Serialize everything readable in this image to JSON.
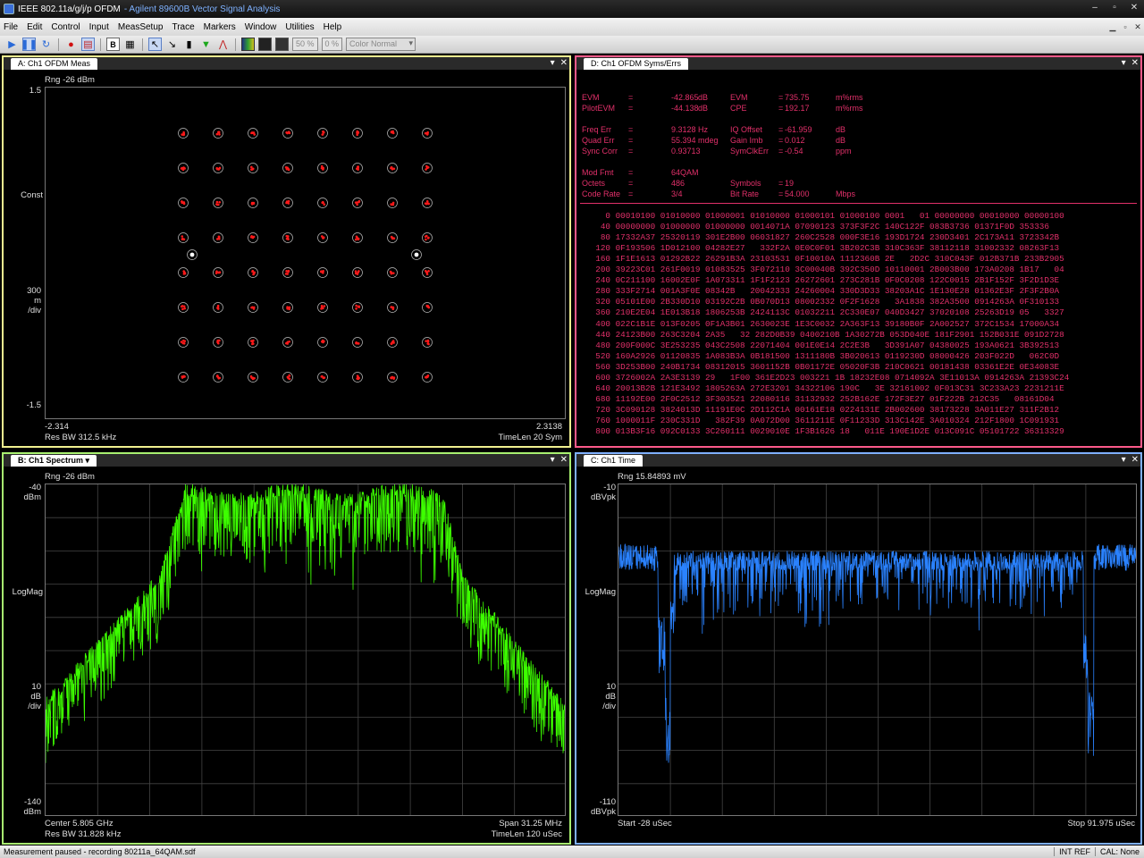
{
  "window": {
    "title": "IEEE 802.11a/g/j/p OFDM",
    "app": "- Agilent 89600B Vector Signal Analysis",
    "buttons": [
      "–",
      "▫",
      "✕"
    ]
  },
  "menu": [
    "File",
    "Edit",
    "Control",
    "Input",
    "MeasSetup",
    "Trace",
    "Markers",
    "Window",
    "Utilities",
    "Help"
  ],
  "toolbar": {
    "zoom1": "50 %",
    "zoom2": "0 %",
    "color_scheme": "Color Normal"
  },
  "panes": {
    "a": {
      "tab": "A: Ch1 OFDM Meas",
      "range": "Rng -26 dBm",
      "y_top": "1.5",
      "y_mid": "Const",
      "y_scale": [
        "300",
        "m",
        "/div"
      ],
      "y_bottom": "-1.5",
      "x_left": "-2.314",
      "x_right": "2.3138",
      "foot_left": "Res BW 312.5 kHz",
      "foot_right": "TimeLen 20  Sym"
    },
    "b": {
      "tab": "B: Ch1 Spectrum",
      "range": "Rng -26 dBm",
      "y_top": [
        "-40",
        "dBm"
      ],
      "y_mid": "LogMag",
      "y_scale": [
        "10",
        "dB",
        "/div"
      ],
      "y_bottom": [
        "-140",
        "dBm"
      ],
      "foot_left_1": "Center 5.805 GHz",
      "foot_right_1": "Span 31.25 MHz",
      "foot_left_2": "Res BW 31.828 kHz",
      "foot_right_2": "TimeLen 120 uSec"
    },
    "c": {
      "tab": "C: Ch1 Time",
      "range": "Rng 15.84893 mV",
      "y_top": [
        "-10",
        "dBVpk"
      ],
      "y_mid": "LogMag",
      "y_scale": [
        "10",
        "dB",
        "/div"
      ],
      "y_bottom": [
        "-110",
        "dBVpk"
      ],
      "foot_left": "Start -28 uSec",
      "foot_right": "Stop 91.975 uSec"
    },
    "d": {
      "tab": "D: Ch1 OFDM Syms/Errs",
      "summary": [
        [
          "EVM",
          "=",
          "-42.865",
          "dB",
          "EVM",
          "=",
          "735.75",
          "m%rms"
        ],
        [
          "PilotEVM",
          "=",
          "-44.138",
          "dB",
          "CPE",
          "=",
          "192.17",
          "m%rms"
        ],
        [
          "Freq Err",
          "=",
          "9.3128",
          "Hz",
          "IQ  Offset",
          "=",
          "-61.959",
          "dB"
        ],
        [
          "Quad Err",
          "=",
          "55.394",
          "mdeg",
          "Gain  Imb",
          "=",
          "0.012",
          "dB"
        ],
        [
          "Sync Corr",
          "=",
          "0.93713",
          "",
          "SymClkErr",
          "=",
          "-0.54",
          "ppm"
        ],
        [
          "Mod Fmt",
          "=",
          "64QAM",
          "",
          "",
          "",
          "",
          ""
        ],
        [
          "Octets",
          "=",
          "486",
          "",
          "Symbols",
          "=",
          "19",
          ""
        ],
        [
          "Code Rate",
          "=",
          "3/4",
          "",
          "Bit    Rate",
          "=",
          "54.000",
          "Mbps"
        ]
      ],
      "hex_rows": [
        [
          "0",
          "00010100 01010000 01000001 01010000 01000101 01000100 0001   01 00000000 00010000 00000100"
        ],
        [
          "40",
          "00000000 01000000 01000000 0014071A 07090123 373F3F2C 140C122F 083B3736 01371F0D 353336"
        ],
        [
          "80",
          "17332A37 25320119 301E2B00 06031827 260C2528 000F3E16 193D1724 230D3401 2C173A11 3723342B"
        ],
        [
          "120",
          "0F193506 1D012100 04282E27   332F2A 0E0C0F01 3B202C3B 310C363F 38112118 31002332 08263F13"
        ],
        [
          "160",
          "1F1E1613 01292B22 26291B3A 23103531 0F10010A 1112360B 2E   2D2C 310C043F 012B371B 233B2905"
        ],
        [
          "200",
          "39223C01 261F0019 01083525 3F072110 3C00040B 392C350D 10110001 2B003B00 173A0208 1B17   04"
        ],
        [
          "240",
          "0C211100 16002E0F 1A073311 1F1F2123 26272601 273C281B 0F0C0208 122C0015 2B1F152F 3F2D1D3E"
        ],
        [
          "280",
          "333F2714 001A3F0E 08342B   20042333 24260004 330D3D33 38203A1C 1E130E28 01362E3F 2F3F2B0A"
        ],
        [
          "320",
          "05101E00 2B330D10 03192C2B 0B070D13 08002332 0F2F1628   3A1838 382A3500 0914263A 0F310133"
        ],
        [
          "360",
          "210E2E04 1E013B18 1806253B 2424113C 01032211 2C330E07 040D3427 37020108 25263D19 05   3327"
        ],
        [
          "400",
          "022C1B1E 013F0205 0F1A3B01 2630023E 1E3C0032 2A363F13 39180B0F 2A002527 372C1534 17000A34"
        ],
        [
          "440",
          "24123B00 263C3204 2A35   32 282D0B39 0400210B 1A30272B 053D040E 181F2901 152B031E 091D2728"
        ],
        [
          "480",
          "200F000C 3E253235 043C2508 22071404 001E0E14 2C2E3B   3D391A07 04380025 193A0621 3B392513"
        ],
        [
          "520",
          "160A2926 01120835 1A083B3A 0B181500 1311180B 3B020613 0119230D 08000426 203F022D   062C0D"
        ],
        [
          "560",
          "3D253B00 240B1734 08312015 3601152B 0B01172E 05020F3B 210C0621 00181438 03361E2E 0E34083E"
        ],
        [
          "600",
          "3726002A 2A3E3139 29   1F00 361E2D23 003221 1B 18232E08 0714092A 3E11013A 0914263A 21393C24"
        ],
        [
          "640",
          "20013B2B 121E3492 1805263A 272E3201 34322106 190C   3E 32161002 0F013C31 3C233A23 2231211E"
        ],
        [
          "680",
          "11192E00 2F0C2512 3F303521 22080116 31132932 252B162E 172F3E27 01F222B 212C35   08161D04"
        ],
        [
          "720",
          "3C090128 3824013D 11191E0C 2D112C1A 00161E18 0224131E 2B002600 38173228 3A011E27 311F2B12"
        ],
        [
          "760",
          "1000011F 230C331D   382F39 0A072D00 3611211E 0F11233D 313C142E 3A010324 212F1800 1C091931"
        ],
        [
          "800",
          "013B3F16 092C0133 3C260111 0029010E 1F3B1626 18   011E 190E1D2E 013C091C 05101722 36313329"
        ]
      ]
    }
  },
  "status": {
    "message": "Measurement paused - recording 80211a_64QAM.sdf",
    "ref": "INT REF",
    "cal": "CAL: None"
  },
  "colors": {
    "pane_a": "#f0f090",
    "pane_b": "#a8f070",
    "pane_c": "#7fb0ff",
    "pane_d": "#ff5a8a",
    "spectrum": "#3dff00",
    "time": "#2a82ff",
    "constellation": "#ff1a1a"
  }
}
